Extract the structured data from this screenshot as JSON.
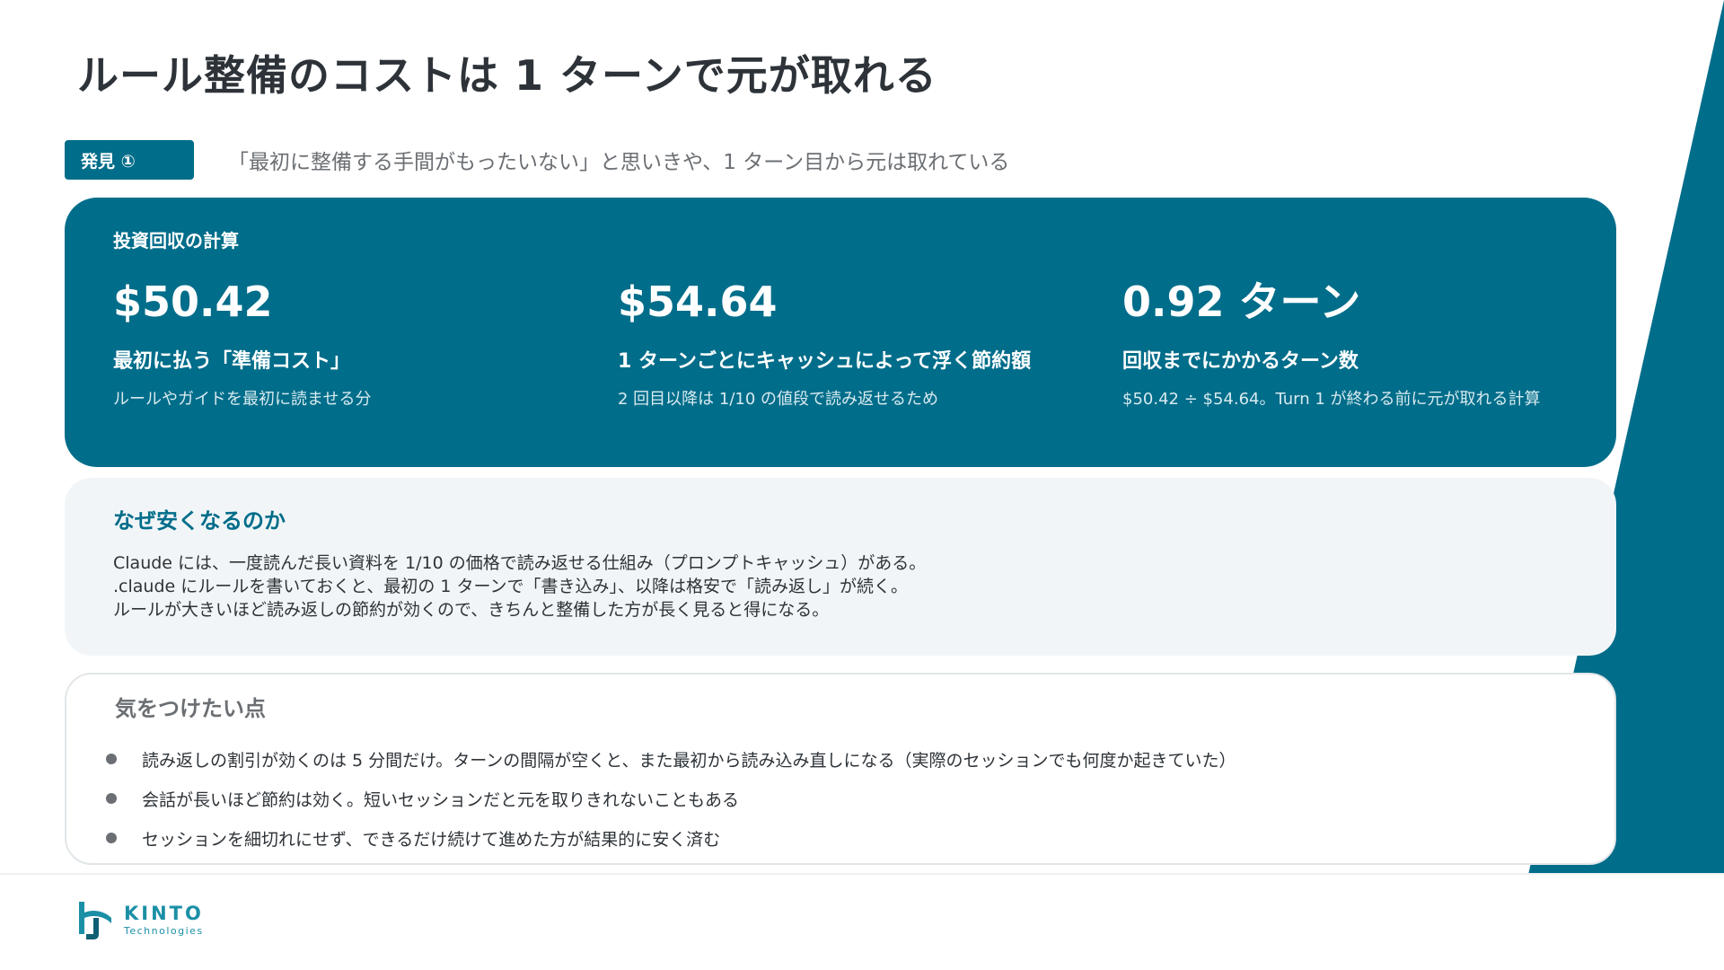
{
  "slide": {
    "title": "ルール整備のコストは 1 ターンで元が取れる",
    "accent_color": "#006d8a"
  },
  "finding": {
    "badge": "発見 ①",
    "text": "「最初に整備する手間がもったいない」と思いきや、1 ターン目から元は取れている"
  },
  "roi": {
    "title": "投資回収の計算",
    "metrics": [
      {
        "value": "$50.42",
        "label": "最初に払う「準備コスト」",
        "desc": "ルールやガイドを最初に読ませる分"
      },
      {
        "value": "$54.64",
        "label": "1 ターンごとにキャッシュによって浮く節約額",
        "desc": "2 回目以降は 1/10 の値段で読み返せるため"
      },
      {
        "value": "0.92 ターン",
        "label": "回収までにかかるターン数",
        "desc": "$50.42 ÷ $54.64。Turn 1 が終わる前に元が取れる計算"
      }
    ]
  },
  "why": {
    "title": "なぜ安くなるのか",
    "lines": [
      "Claude には、一度読んだ長い資料を 1/10 の価格で読み返せる仕組み（プロンプトキャッシュ）がある。",
      ".claude にルールを書いておくと、最初の 1 ターンで「書き込み」、以降は格安で「読み返し」が続く。",
      "ルールが大きいほど読み返しの節約が効くので、きちんと整備した方が長く見ると得になる。"
    ]
  },
  "caution": {
    "title": "気をつけたい点",
    "items": [
      "読み返しの割引が効くのは 5 分間だけ。ターンの間隔が空くと、また最初から読み込み直しになる（実際のセッションでも何度か起きていた）",
      "会話が長いほど節約は効く。短いセッションだと元を取りきれないこともある",
      "セッションを細切れにせず、できるだけ続けて進めた方が結果的に安く済む"
    ]
  },
  "logo": {
    "name": "KINTO",
    "sub": "Technologies",
    "icon": "kinto-logo-icon"
  }
}
